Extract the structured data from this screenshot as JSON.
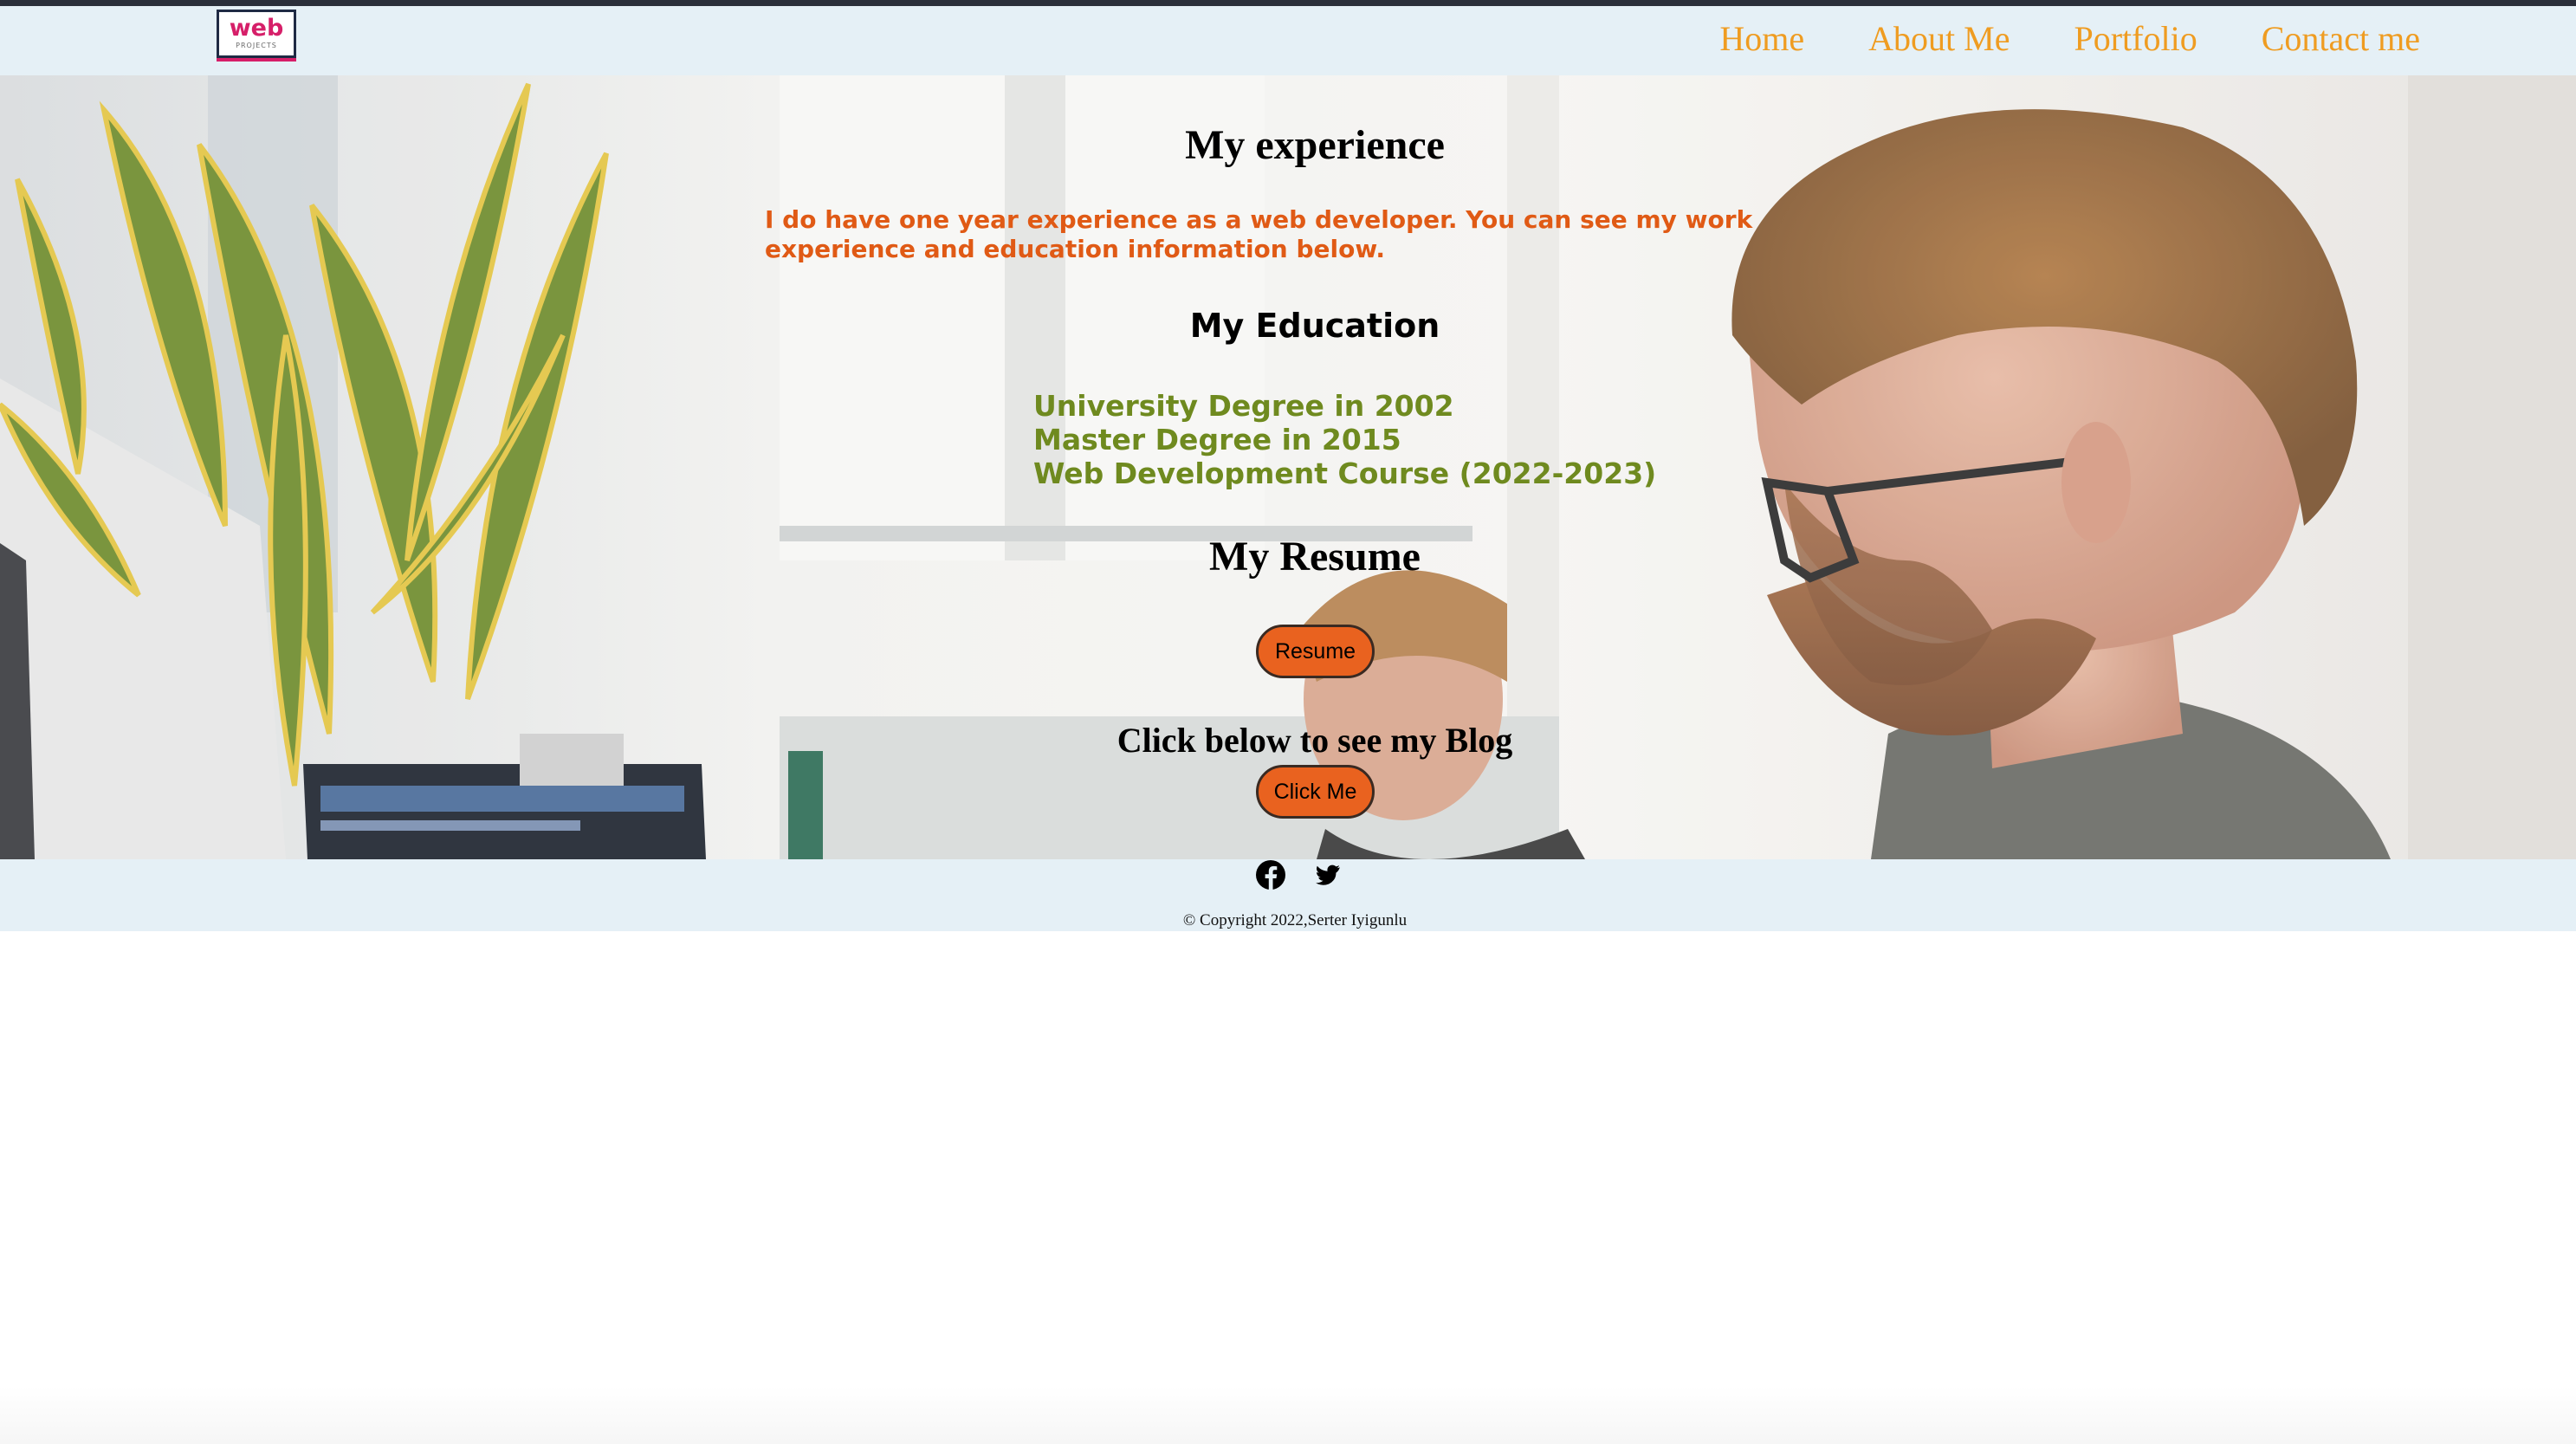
{
  "header": {
    "logo_text": "web",
    "logo_subtext": "PROJECTS",
    "nav": [
      {
        "label": "Home"
      },
      {
        "label": "About Me"
      },
      {
        "label": "Portfolio"
      },
      {
        "label": "Contact me"
      }
    ],
    "accent_color": "#ef9c21"
  },
  "main": {
    "experience_title": "My experience",
    "experience_text": "I do have one year experience as a web developer. You can see my work experience and education information below.",
    "education_title": "My Education",
    "education_items": [
      "University Degree in 2002",
      "Master Degree in 2015",
      "Web Development Course (2022-2023)"
    ],
    "resume_title": "My Resume",
    "resume_button": "Resume",
    "blog_prompt": "Click below to see my Blog",
    "blog_button": "Click Me"
  },
  "footer": {
    "social": [
      {
        "icon": "facebook-icon"
      },
      {
        "icon": "twitter-icon"
      }
    ],
    "copyright": "© Copyright 2022,Serter Iyigunlu"
  },
  "colors": {
    "nav_bg": "#e5f0f6",
    "intro_text": "#e05a15",
    "education_text": "#6f8a1f",
    "button_bg": "#e9621f"
  }
}
